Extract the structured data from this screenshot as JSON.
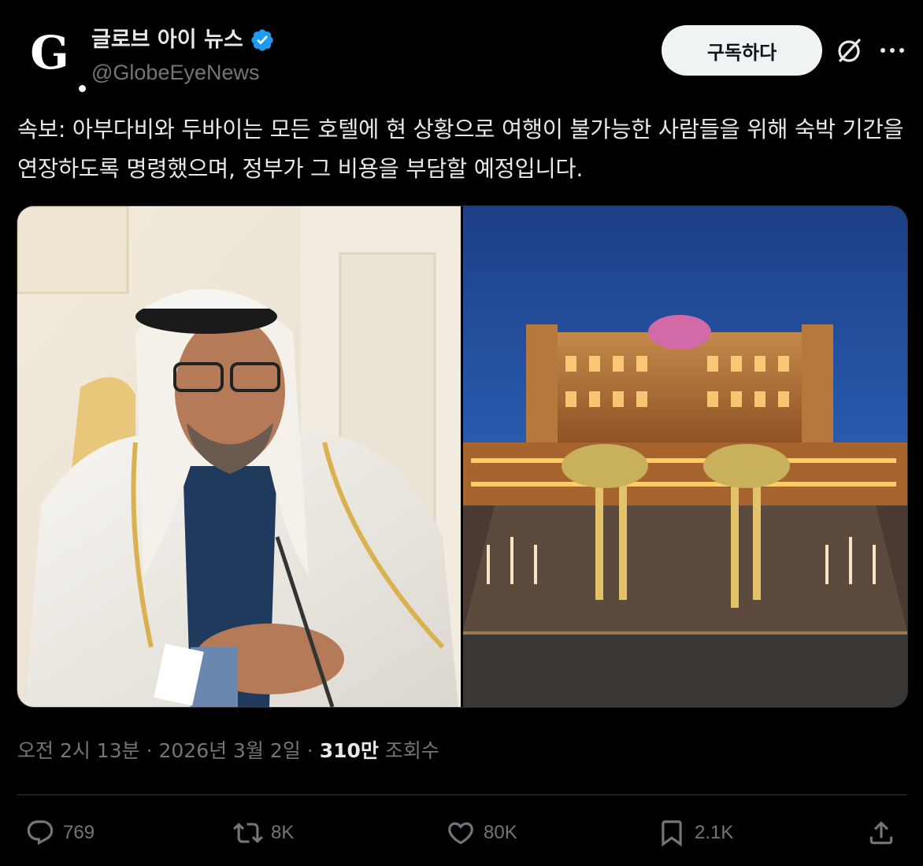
{
  "author": {
    "avatar_letter": "G",
    "display_name": "글로브 아이 뉴스",
    "handle": "@GlobeEyeNews",
    "verified_color": "#1d9bf0"
  },
  "header": {
    "subscribe_label": "구독하다",
    "grok_icon": "grok-icon",
    "more_icon": "more-icon"
  },
  "post": {
    "text": "속보: 아부다비와 두바이는 모든 호텔에 현 상황으로 여행이 불가능한 사람들을 위해 숙박 기간을 연장하도록 명령했으며, 정부가 그 비용을 부담할 예정입니다."
  },
  "meta": {
    "time": "오전 2시 13분",
    "separator": "·",
    "date": "2026년 3월 2일",
    "views_count": "310만",
    "views_label": "조회수"
  },
  "actions": {
    "replies": "769",
    "reposts": "8K",
    "likes": "80K",
    "bookmarks": "2.1K"
  },
  "colors": {
    "background": "#000000",
    "text": "#e7e9ea",
    "muted": "#71767b",
    "divider": "#2f3336",
    "button_bg": "#eff3f4"
  }
}
